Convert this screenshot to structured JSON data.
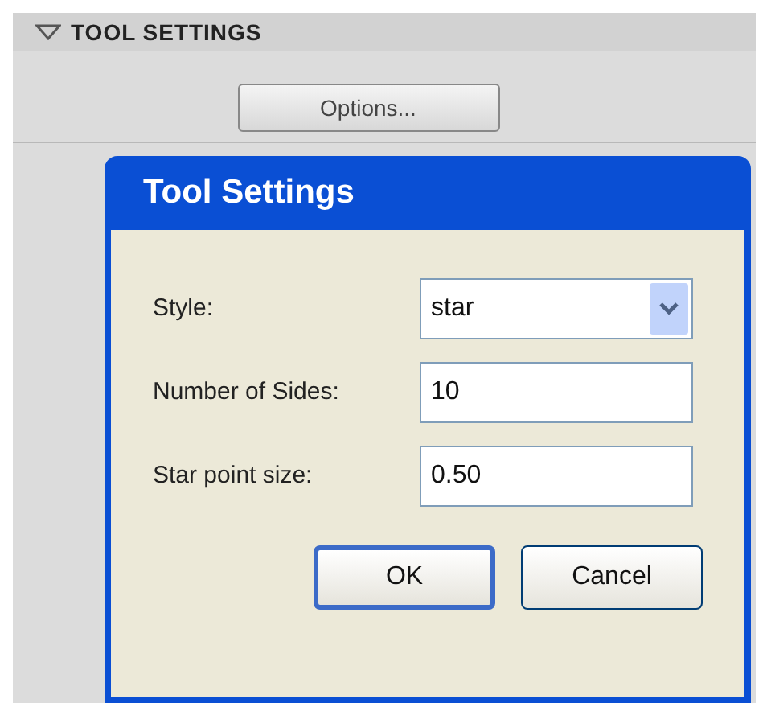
{
  "panel": {
    "title": "TOOL SETTINGS",
    "expanded": true,
    "button": "Options..."
  },
  "dialog": {
    "title": "Tool Settings",
    "fields": [
      {
        "kind": "select",
        "label": "Style:",
        "value": "star"
      },
      {
        "kind": "text",
        "label": "Number of Sides:",
        "value": "10"
      },
      {
        "kind": "text",
        "label": "Star point size:",
        "value": "0.50"
      }
    ],
    "buttons": [
      {
        "label": "OK",
        "default": true
      },
      {
        "label": "Cancel",
        "default": false
      }
    ]
  }
}
